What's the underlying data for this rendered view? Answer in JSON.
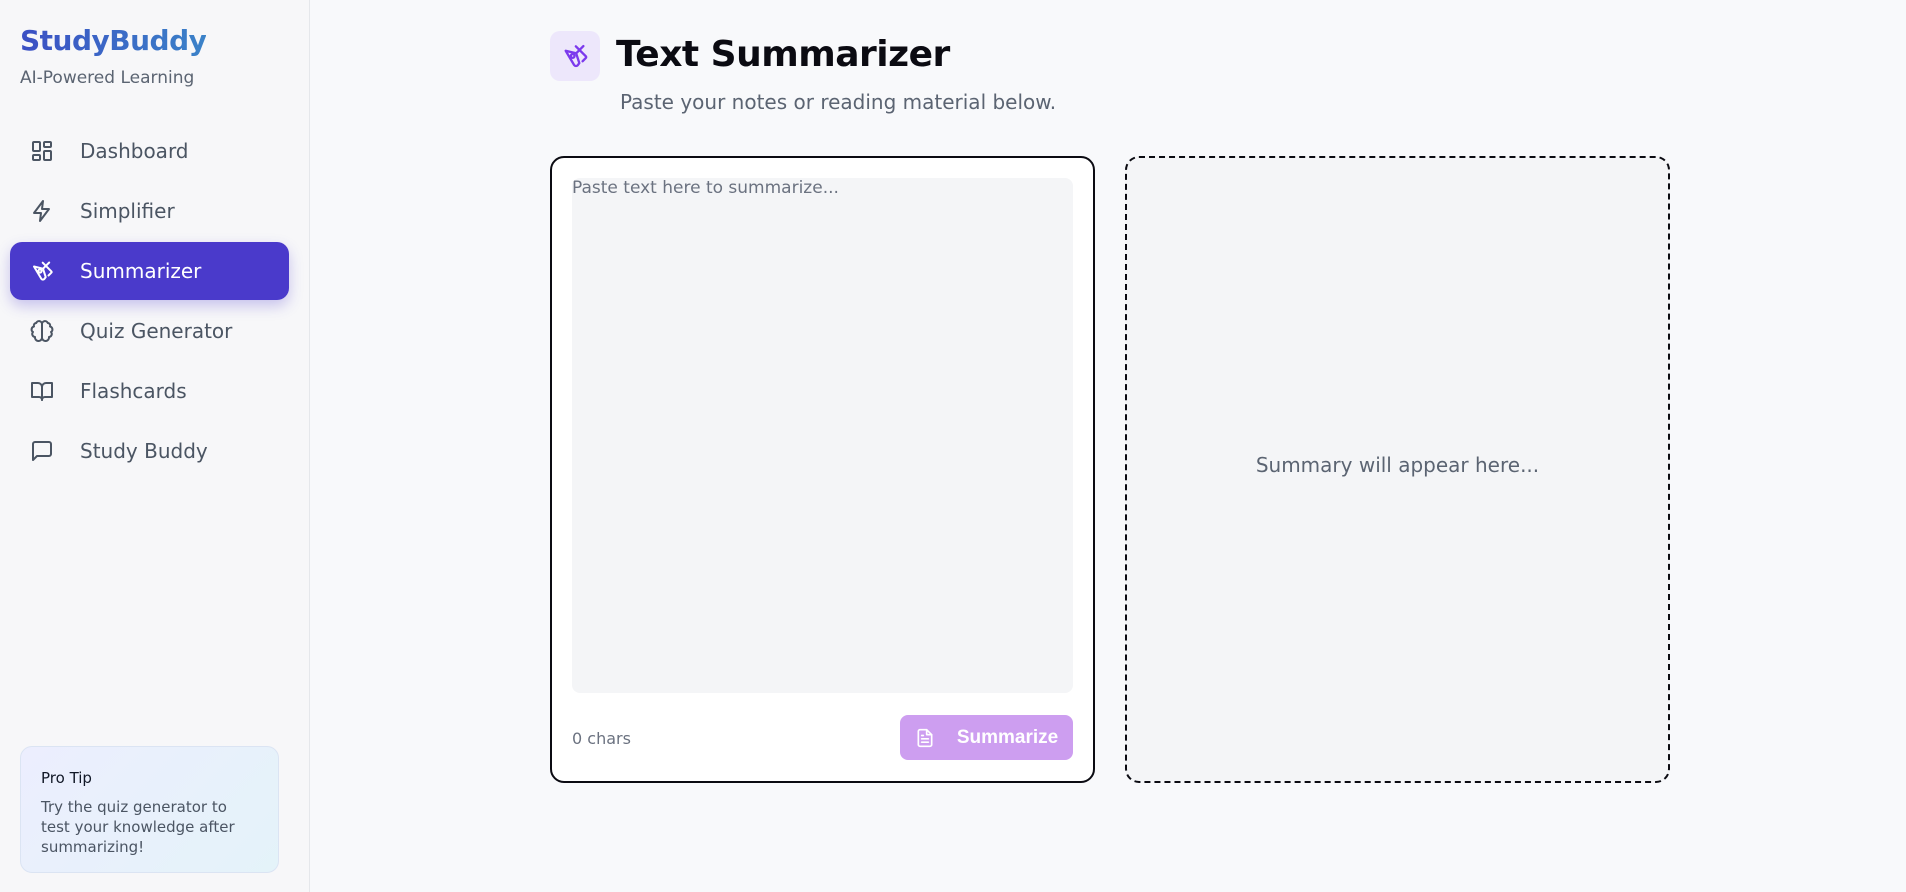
{
  "brand": {
    "name": "StudyBuddy",
    "tagline": "AI-Powered Learning"
  },
  "nav": {
    "items": [
      {
        "label": "Dashboard",
        "icon": "dashboard-grid-icon",
        "active": false
      },
      {
        "label": "Simplifier",
        "icon": "lightning-icon",
        "active": false
      },
      {
        "label": "Summarizer",
        "icon": "pen-tool-icon",
        "active": true
      },
      {
        "label": "Quiz Generator",
        "icon": "brain-icon",
        "active": false
      },
      {
        "label": "Flashcards",
        "icon": "book-open-icon",
        "active": false
      },
      {
        "label": "Study Buddy",
        "icon": "chat-bubble-icon",
        "active": false
      }
    ]
  },
  "tip": {
    "title": "Pro Tip",
    "body": "Try the quiz generator to test your knowledge after summarizing!"
  },
  "header": {
    "icon": "pen-tool-icon",
    "title": "Text Summarizer",
    "subtitle": "Paste your notes or reading material below."
  },
  "input": {
    "placeholder": "Paste text here to summarize...",
    "value": "",
    "char_count": "0 chars",
    "button_label": "Summarize",
    "button_icon": "document-icon"
  },
  "output": {
    "placeholder": "Summary will appear here..."
  },
  "colors": {
    "accent": "#4a3acb",
    "button_disabled": "#cd9ef0",
    "icon_bg": "#ede7fb"
  }
}
